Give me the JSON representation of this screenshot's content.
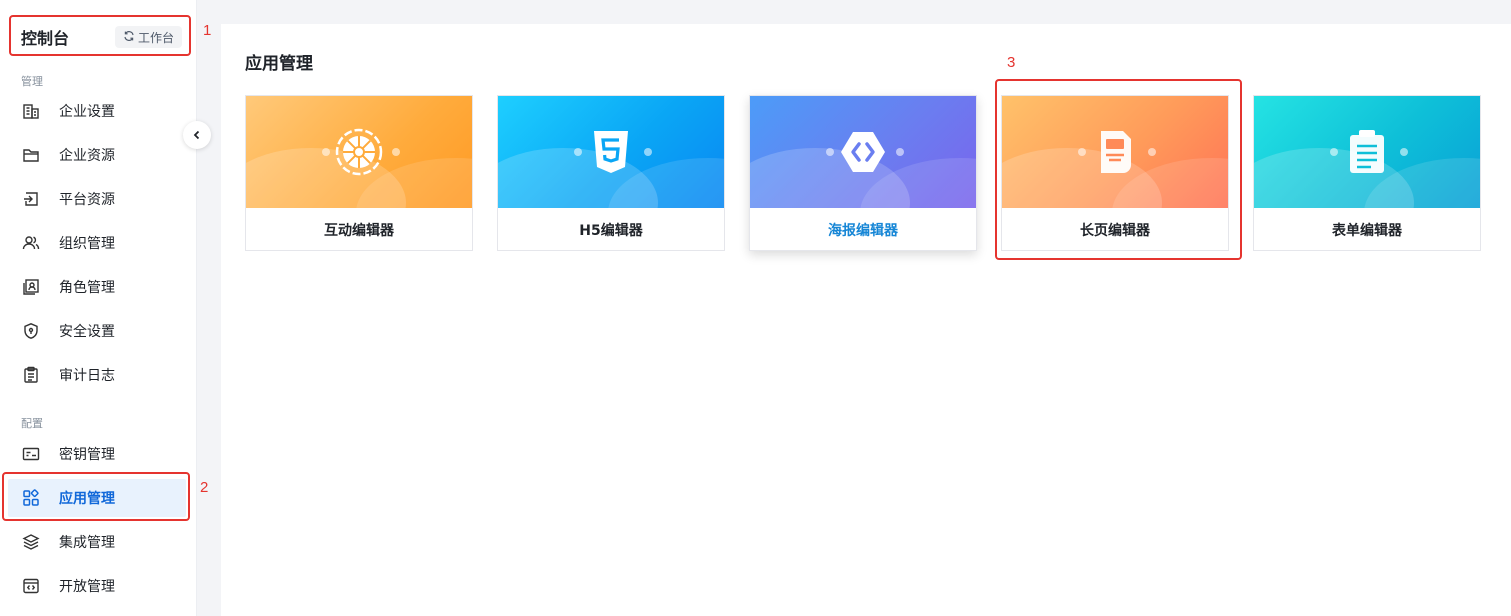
{
  "sidebar": {
    "title": "控制台",
    "switch_label": "工作台",
    "groups": [
      {
        "title": "管理",
        "items": [
          {
            "label": "企业设置",
            "icon": "building-icon"
          },
          {
            "label": "企业资源",
            "icon": "folder-icon"
          },
          {
            "label": "平台资源",
            "icon": "import-icon"
          },
          {
            "label": "组织管理",
            "icon": "users-icon"
          },
          {
            "label": "角色管理",
            "icon": "role-card-icon"
          },
          {
            "label": "安全设置",
            "icon": "shield-icon"
          },
          {
            "label": "审计日志",
            "icon": "clipboard-icon"
          }
        ]
      },
      {
        "title": "配置",
        "items": [
          {
            "label": "密钥管理",
            "icon": "key-card-icon"
          },
          {
            "label": "应用管理",
            "icon": "apps-icon",
            "active": true
          },
          {
            "label": "集成管理",
            "icon": "layers-icon"
          },
          {
            "label": "开放管理",
            "icon": "code-window-icon"
          }
        ]
      }
    ]
  },
  "main": {
    "title": "应用管理",
    "cards": [
      {
        "label": "互动编辑器",
        "icon": "wheel-icon",
        "color": "#ffab3c"
      },
      {
        "label": "H5编辑器",
        "icon": "html5-icon",
        "color": "#0aa6f5"
      },
      {
        "label": "海报编辑器",
        "icon": "poster-icon",
        "color": "#6a7ef0",
        "hovered": true
      },
      {
        "label": "长页编辑器",
        "icon": "long-page-icon",
        "color": "#ff8a58"
      },
      {
        "label": "表单编辑器",
        "icon": "form-icon",
        "color": "#0ebfd8"
      }
    ]
  },
  "annotations": [
    {
      "number": "1",
      "target": "sidebar-header"
    },
    {
      "number": "2",
      "target": "nav-app-management"
    },
    {
      "number": "3",
      "target": "long-page-editor-card"
    }
  ],
  "colors": {
    "accent": "#1168d9",
    "annotation": "#e5342f"
  }
}
